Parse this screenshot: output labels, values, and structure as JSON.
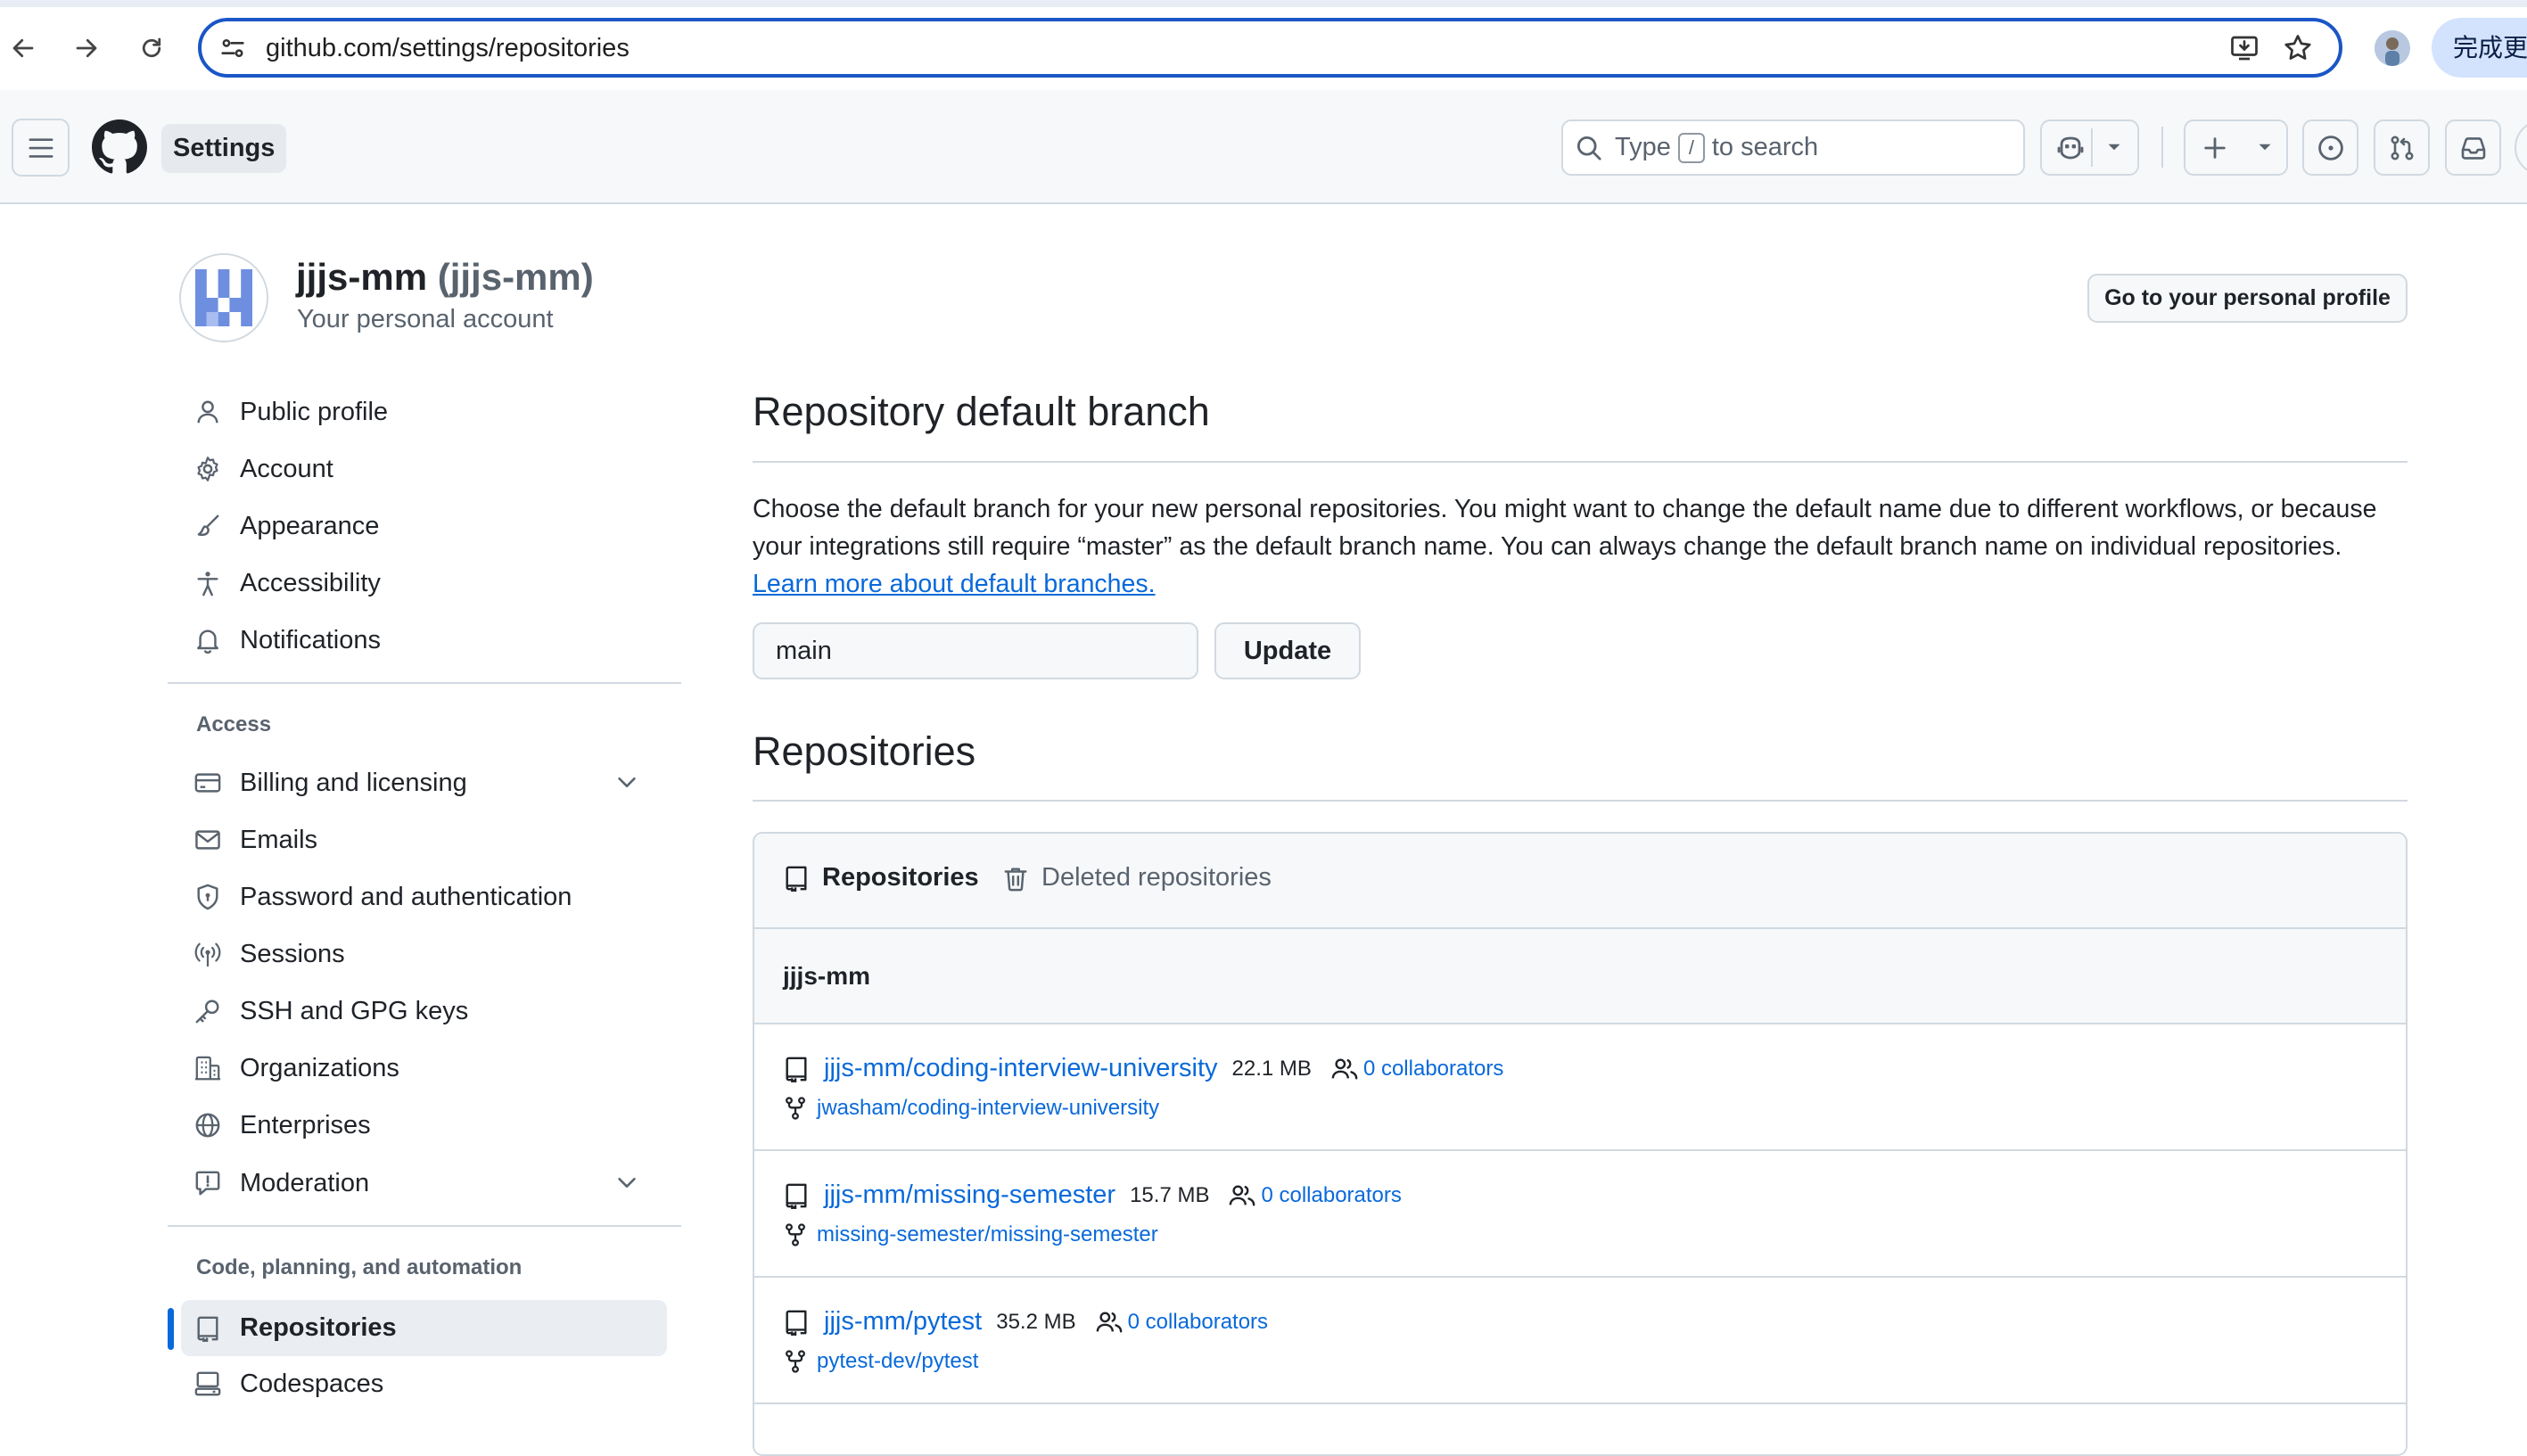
{
  "browser": {
    "url": "github.com/settings/repositories",
    "update_label": "完成更新",
    "icons": [
      "back-icon",
      "forward-icon",
      "reload-icon",
      "site-info-icon",
      "install-icon",
      "bookmark-star-icon",
      "profile-avatar"
    ]
  },
  "header": {
    "context_title": "Settings",
    "search": {
      "prefix": "Type",
      "key": "/",
      "suffix": "to search"
    },
    "icons": [
      "menu-icon",
      "github-logo",
      "copilot-icon",
      "plus-icon",
      "issues-icon",
      "pull-requests-icon",
      "inbox-icon"
    ]
  },
  "account": {
    "display_name": "jjjs-mm",
    "login": "(jjjs-mm)",
    "subtitle": "Your personal account",
    "profile_button": "Go to your personal profile"
  },
  "sidebar": {
    "top_items": [
      {
        "label": "Public profile",
        "icon": "person-icon"
      },
      {
        "label": "Account",
        "icon": "gear-icon"
      },
      {
        "label": "Appearance",
        "icon": "paintbrush-icon"
      },
      {
        "label": "Accessibility",
        "icon": "accessibility-icon"
      },
      {
        "label": "Notifications",
        "icon": "bell-icon"
      }
    ],
    "access_heading": "Access",
    "access_items": [
      {
        "label": "Billing and licensing",
        "icon": "credit-card-icon"
      },
      {
        "label": "Emails",
        "icon": "mail-icon"
      },
      {
        "label": "Password and authentication",
        "icon": "shield-lock-icon"
      },
      {
        "label": "Sessions",
        "icon": "broadcast-icon"
      },
      {
        "label": "SSH and GPG keys",
        "icon": "key-icon"
      },
      {
        "label": "Organizations",
        "icon": "organization-icon"
      },
      {
        "label": "Enterprises",
        "icon": "globe-icon"
      },
      {
        "label": "Moderation",
        "icon": "report-icon"
      }
    ],
    "code_heading": "Code, planning, and automation",
    "code_items": [
      {
        "label": "Repositories",
        "icon": "repo-icon",
        "active": true
      },
      {
        "label": "Codespaces",
        "icon": "codespaces-icon"
      }
    ]
  },
  "main": {
    "branch_section": {
      "title": "Repository default branch",
      "description": "Choose the default branch for your new personal repositories. You might want to change the default name due to different workflows, or because your integrations still require “master” as the default branch name. You can always change the default branch name on individual repositories.",
      "learn_more": "Learn more about default branches.",
      "input_value": "main",
      "update_button": "Update"
    },
    "repos_section": {
      "title": "Repositories",
      "tabs": [
        {
          "label": "Repositories",
          "icon": "repo-icon",
          "selected": true
        },
        {
          "label": "Deleted repositories",
          "icon": "trash-icon",
          "selected": false
        }
      ],
      "owner": "jjjs-mm",
      "repos": [
        {
          "name": "jjjs-mm/coding-interview-university",
          "size": "22.1 MB",
          "collaborators": "0 collaborators",
          "fork_of": "jwasham/coding-interview-university"
        },
        {
          "name": "jjjs-mm/missing-semester",
          "size": "15.7 MB",
          "collaborators": "0 collaborators",
          "fork_of": "missing-semester/missing-semester"
        },
        {
          "name": "jjjs-mm/pytest",
          "size": "35.2 MB",
          "collaborators": "0 collaborators",
          "fork_of": "pytest-dev/pytest"
        }
      ]
    }
  },
  "colors": {
    "link": "#0969da",
    "border": "#d1d9e0",
    "muted": "#59636e",
    "accent_bar": "#0969da",
    "omnibox_focus": "#1a56c7"
  }
}
